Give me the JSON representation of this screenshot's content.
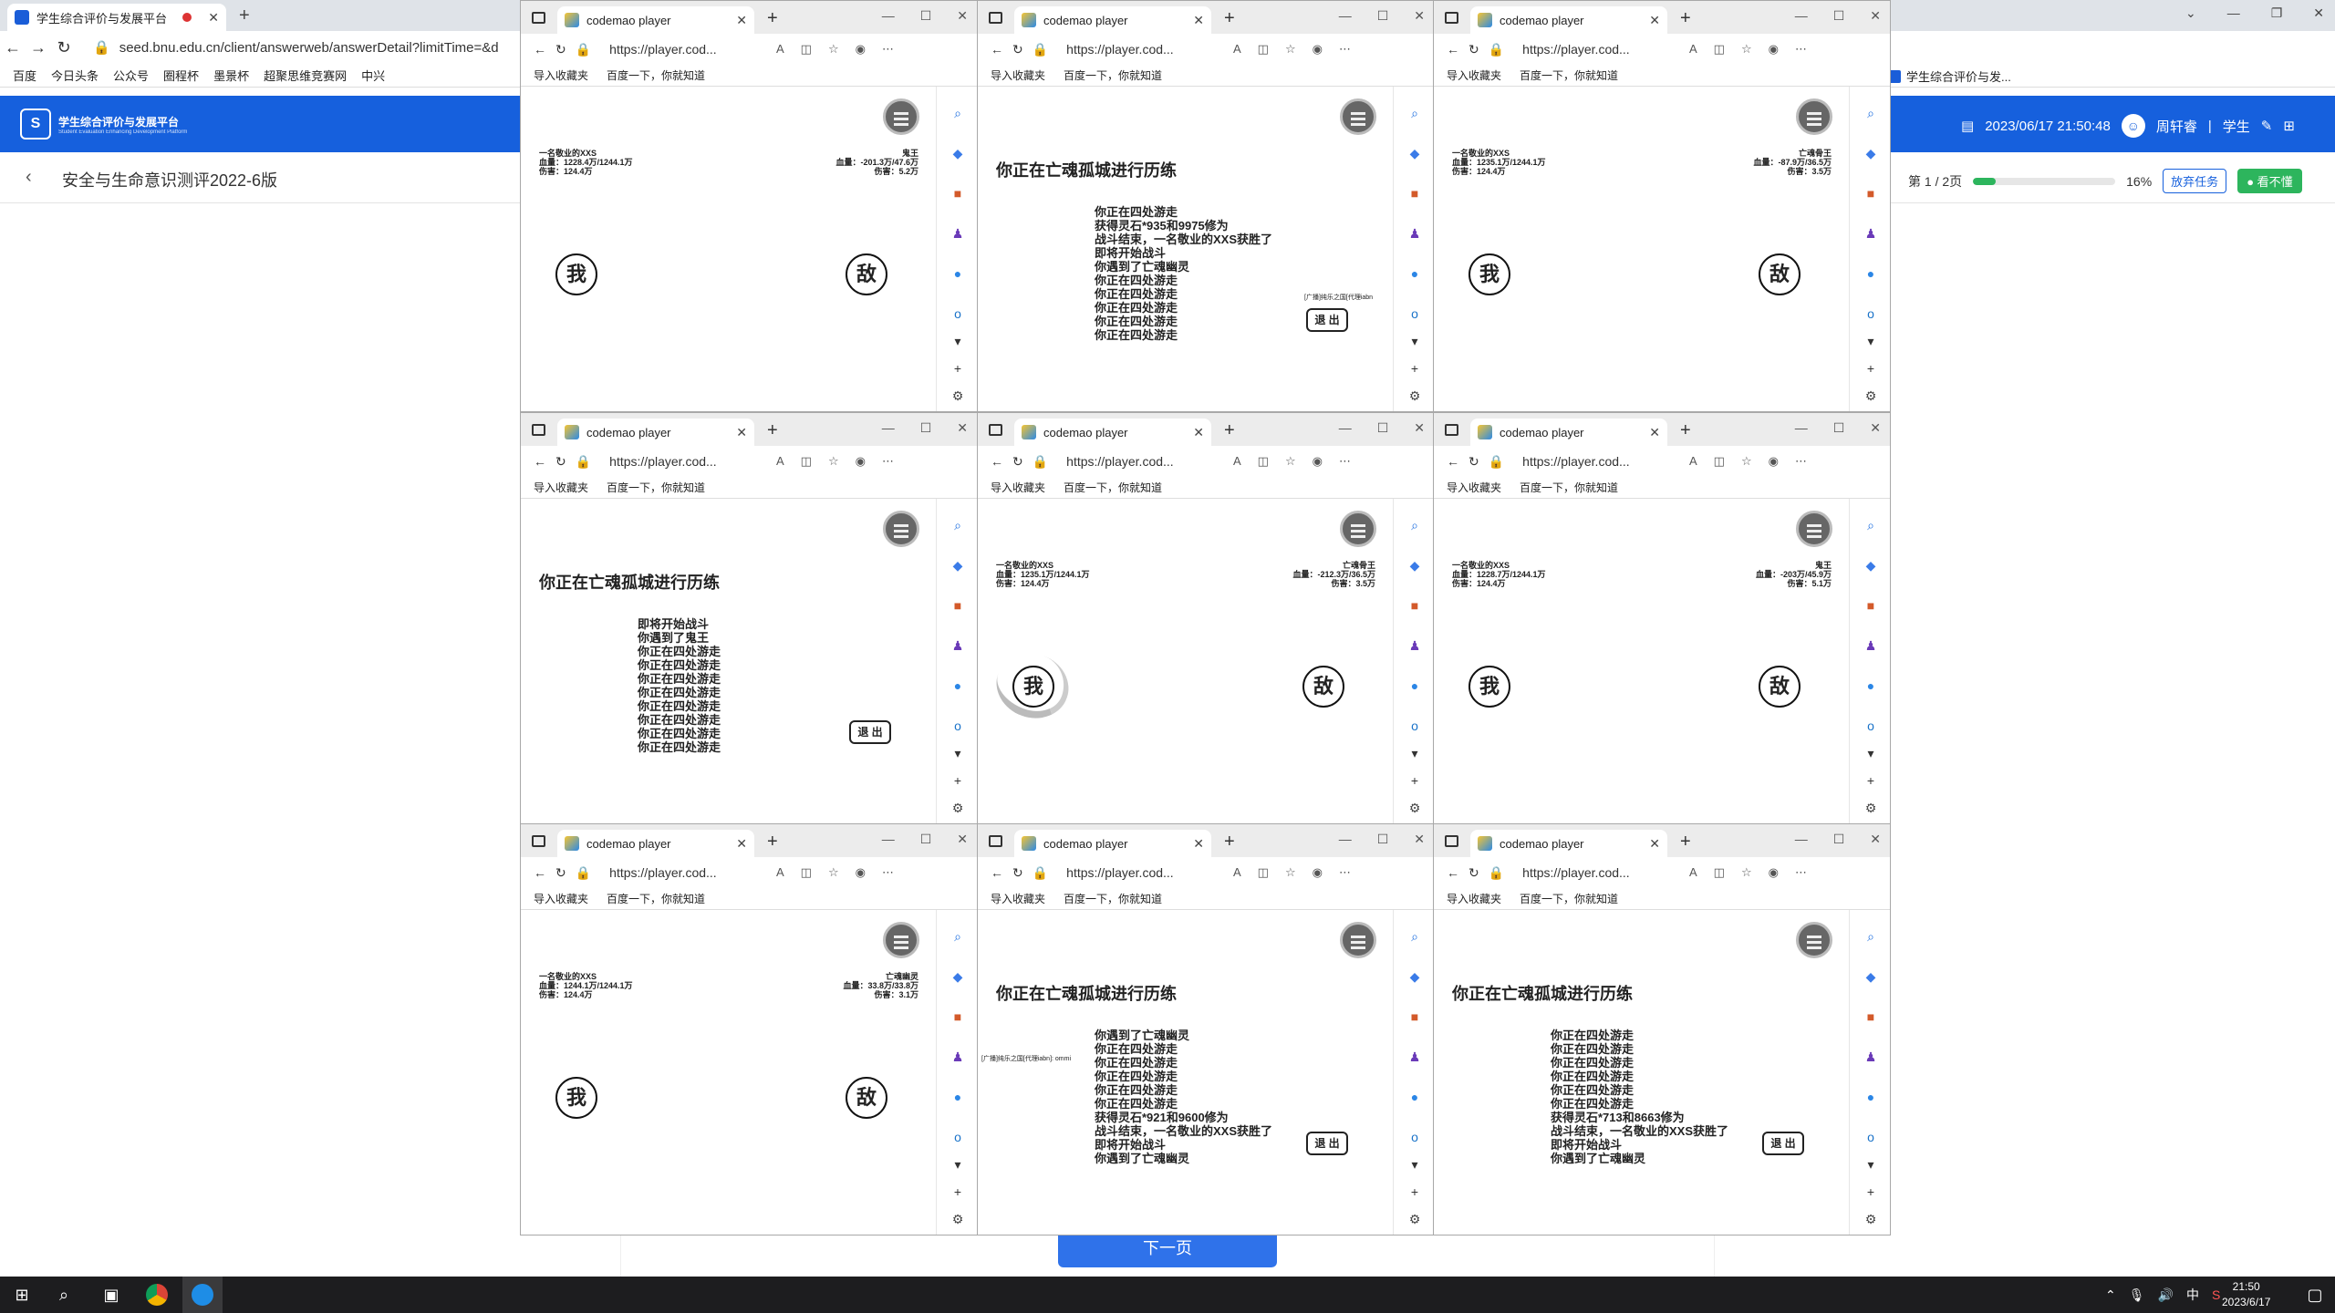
{
  "back_browser": {
    "tab_title": "学生综合评价与发展平台",
    "url": "seed.bnu.edu.cn/client/answerweb/answerDetail?limitTime=&d",
    "favorites": [
      "百度",
      "今日头条",
      "公众号",
      "圈程杯",
      "墨景杯",
      "超聚思维竞赛网",
      "中兴"
    ],
    "favorites_right": "学生综合评价与发..."
  },
  "app": {
    "logo_title": "学生综合评价与发展平台",
    "logo_subtitle": "Student Evaluation Enhancing Development Platform",
    "datetime": "2023/06/17 21:50:48",
    "username": "周轩睿",
    "role": "学生",
    "survey_title": "安全与生命意识测评2022-6版",
    "page_indicator": "第 1 / 2页",
    "progress_percent": 16,
    "progress_text": "16%",
    "abandon_label": "放弃任务",
    "feel_label": "● 看不懂",
    "next_label": "下一页"
  },
  "window_common": {
    "tab_title": "codemao player",
    "url": "https://player.cod...",
    "fav_import": "导入收藏夹",
    "fav_baidu": "百度一下，你就知道",
    "me": "我",
    "enemy": "敌",
    "exit": "退 出"
  },
  "windows": [
    {
      "type": "battle",
      "player_name": "一名敬业的XXS",
      "player_hp": "血量：1228.4万/1244.1万",
      "player_atk": "伤害：124.4万",
      "enemy_name": "鬼王",
      "enemy_hp": "血量：-201.3万/47.6万",
      "enemy_atk": "伤害：5.2万"
    },
    {
      "type": "log",
      "heading": "你正在亡魂孤城进行历练",
      "lines": [
        "你正在四处游走",
        "获得灵石*935和9975修为",
        "战斗结束，一名敬业的XXS获胜了",
        "即将开始战斗",
        "你遇到了亡魂幽灵",
        "你正在四处游走",
        "你正在四处游走",
        "你正在四处游走",
        "你正在四处游走",
        "你正在四处游走"
      ],
      "notice": "[广播]纯乐之国[代理iabn"
    },
    {
      "type": "battle",
      "player_name": "一名敬业的XXS",
      "player_hp": "血量：1235.1万/1244.1万",
      "player_atk": "伤害：124.4万",
      "enemy_name": "亡魂骨王",
      "enemy_hp": "血量：-87.9万/36.5万",
      "enemy_atk": "伤害：3.5万"
    },
    {
      "type": "log",
      "heading": "你正在亡魂孤城进行历练",
      "lines": [
        "即将开始战斗",
        "你遇到了鬼王",
        "你正在四处游走",
        "你正在四处游走",
        "你正在四处游走",
        "你正在四处游走",
        "你正在四处游走",
        "你正在四处游走",
        "你正在四处游走",
        "你正在四处游走"
      ],
      "notice": ""
    },
    {
      "type": "battle",
      "player_name": "一名敬业的XXS",
      "player_hp": "血量：1235.1万/1244.1万",
      "player_atk": "伤害：124.4万",
      "enemy_name": "亡魂骨王",
      "enemy_hp": "血量：-212.3万/36.5万",
      "enemy_atk": "伤害：3.5万",
      "swoosh": true
    },
    {
      "type": "battle",
      "player_name": "一名敬业的XXS",
      "player_hp": "血量：1228.7万/1244.1万",
      "player_atk": "伤害：124.4万",
      "enemy_name": "鬼王",
      "enemy_hp": "血量：-203万/45.9万",
      "enemy_atk": "伤害：5.1万"
    },
    {
      "type": "battle",
      "player_name": "一名敬业的XXS",
      "player_hp": "血量：1244.1万/1244.1万",
      "player_atk": "伤害：124.4万",
      "enemy_name": "亡魂幽灵",
      "enemy_hp": "血量：33.8万/33.8万",
      "enemy_atk": "伤害：3.1万"
    },
    {
      "type": "log",
      "heading": "你正在亡魂孤城进行历练",
      "lines": [
        "你遇到了亡魂幽灵",
        "你正在四处游走",
        "你正在四处游走",
        "你正在四处游走",
        "你正在四处游走",
        "你正在四处游走",
        "获得灵石*921和9600修为",
        "战斗结束，一名敬业的XXS获胜了",
        "即将开始战斗",
        "你遇到了亡魂幽灵"
      ],
      "notice": "[广播]纯乐之国[代理iabn]: ommi"
    },
    {
      "type": "log",
      "heading": "你正在亡魂孤城进行历练",
      "lines": [
        "你正在四处游走",
        "你正在四处游走",
        "你正在四处游走",
        "你正在四处游走",
        "你正在四处游走",
        "你正在四处游走",
        "获得灵石*713和8663修为",
        "战斗结束，一名敬业的XXS获胜了",
        "即将开始战斗",
        "你遇到了亡魂幽灵"
      ],
      "notice": ""
    }
  ],
  "taskbar": {
    "time": "21:50",
    "date": "2023/6/17",
    "ime": "中"
  },
  "colors": {
    "brand_blue": "#1660dd",
    "progress_green": "#2db55d"
  }
}
